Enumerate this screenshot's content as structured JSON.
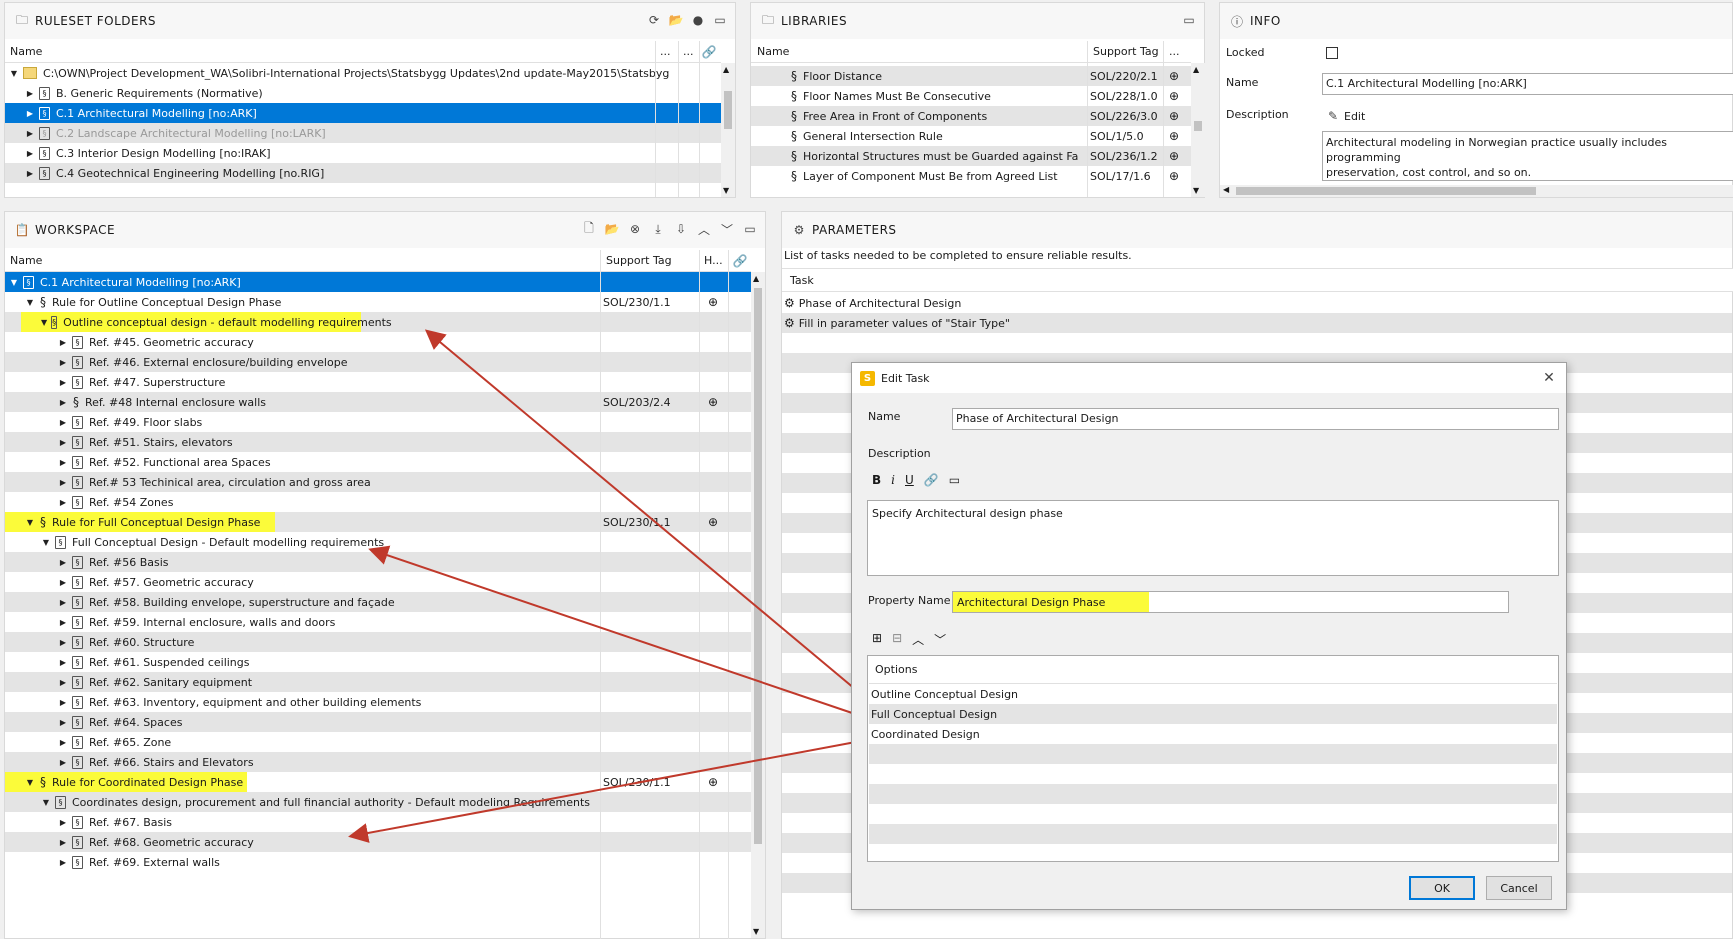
{
  "ruleset": {
    "title": "RULESET FOLDERS",
    "col_name": "Name",
    "col_dots1": "...",
    "col_dots2": "...",
    "rows": [
      {
        "label": "C:\\OWN\\Project Development_WA\\Solibri-International Projects\\Statsbygg Updates\\2nd update-May2015\\Statsbyg"
      },
      {
        "label": "B. Generic Requirements (Normative)"
      },
      {
        "label": "C.1 Architectural Modelling [no:ARK]"
      },
      {
        "label": "C.2 Landscape Architectural Modelling [no:LARK]"
      },
      {
        "label": "C.3 Interior Design Modelling [no:IRAK]"
      },
      {
        "label": "C.4 Geotechnical Engineering Modelling [no.RIG]"
      }
    ]
  },
  "libraries": {
    "title": "LIBRARIES",
    "col_name": "Name",
    "col_tag": "Support Tag",
    "col_dots": "...",
    "rows": [
      {
        "name": "Floor Distance",
        "tag": "SOL/220/2.1"
      },
      {
        "name": "Floor Names Must Be Consecutive",
        "tag": "SOL/228/1.0"
      },
      {
        "name": "Free Area in Front of Components",
        "tag": "SOL/226/3.0"
      },
      {
        "name": "General Intersection Rule",
        "tag": "SOL/1/5.0"
      },
      {
        "name": "Horizontal Structures must be Guarded against Fallin",
        "tag": "SOL/236/1.2"
      },
      {
        "name": "Layer of Component Must Be from Agreed List",
        "tag": "SOL/17/1.6"
      }
    ]
  },
  "info": {
    "title": "INFO",
    "locked_label": "Locked",
    "name_label": "Name",
    "name_value": "C.1 Architectural Modelling [no:ARK]",
    "desc_label": "Description",
    "edit_label": "Edit",
    "desc_line1": "Architectural modeling in Norwegian practice usually includes programming",
    "desc_line2": "preservation, cost control, and so on."
  },
  "workspace": {
    "title": "WORKSPACE",
    "col_name": "Name",
    "col_tag": "Support Tag",
    "col_h": "H...",
    "rows": [
      {
        "label": "C.1 Architectural Modelling [no:ARK]",
        "tag": ""
      },
      {
        "label": "Rule for Outline Conceptual Design Phase",
        "tag": "SOL/230/1.1"
      },
      {
        "label": "Outline conceptual design - default modelling requirements",
        "tag": ""
      },
      {
        "label": "Ref. #45. Geometric accuracy",
        "tag": ""
      },
      {
        "label": "Ref. #46. External enclosure/building envelope",
        "tag": ""
      },
      {
        "label": "Ref. #47. Superstructure",
        "tag": ""
      },
      {
        "label": "Ref. #48 Internal enclosure walls",
        "tag": "SOL/203/2.4"
      },
      {
        "label": "Ref. #49. Floor slabs",
        "tag": ""
      },
      {
        "label": "Ref. #51. Stairs, elevators",
        "tag": ""
      },
      {
        "label": "Ref. #52. Functional area Spaces",
        "tag": ""
      },
      {
        "label": "Ref.# 53 Techinical area, circulation and gross area",
        "tag": ""
      },
      {
        "label": "Ref. #54 Zones",
        "tag": ""
      },
      {
        "label": "Rule for Full Conceptual Design Phase",
        "tag": "SOL/230/1.1"
      },
      {
        "label": "Full Conceptual Design - Default modelling requirements",
        "tag": ""
      },
      {
        "label": "Ref. #56 Basis",
        "tag": ""
      },
      {
        "label": "Ref. #57. Geometric accuracy",
        "tag": ""
      },
      {
        "label": "Ref. #58. Building envelope, superstructure and façade",
        "tag": ""
      },
      {
        "label": "Ref. #59. Internal enclosure, walls and doors",
        "tag": ""
      },
      {
        "label": "Ref. #60. Structure",
        "tag": ""
      },
      {
        "label": "Ref. #61. Suspended ceilings",
        "tag": ""
      },
      {
        "label": "Ref. #62. Sanitary equipment",
        "tag": ""
      },
      {
        "label": "Ref. #63. Inventory, equipment and other building elements",
        "tag": ""
      },
      {
        "label": "Ref. #64. Spaces",
        "tag": ""
      },
      {
        "label": "Ref. #65. Zone",
        "tag": ""
      },
      {
        "label": "Ref. #66. Stairs and Elevators",
        "tag": ""
      },
      {
        "label": "Rule for Coordinated Design Phase",
        "tag": "SOL/230/1.1"
      },
      {
        "label": "Coordinates design, procurement and full financial authority - Default modeling Requirements",
        "tag": ""
      },
      {
        "label": "Ref. #67. Basis",
        "tag": ""
      },
      {
        "label": "Ref. #68. Geometric accuracy",
        "tag": ""
      },
      {
        "label": "Ref. #69. External walls",
        "tag": ""
      }
    ]
  },
  "parameters": {
    "title": "PARAMETERS",
    "subtitle": "List of tasks needed to be completed to ensure reliable results.",
    "col_task": "Task",
    "tasks": [
      {
        "label": "Phase of Architectural Design"
      },
      {
        "label": "Fill in parameter values of \"Stair Type\""
      }
    ]
  },
  "dialog": {
    "title": "Edit Task",
    "name_label": "Name",
    "name_value": "Phase of Architectural Design",
    "desc_label": "Description",
    "desc_text": "Specify Architectural design phase",
    "prop_label": "Property Name",
    "prop_value": "Architectural Design Phase",
    "options_header": "Options",
    "options": [
      "Outline Conceptual Design",
      "Full Conceptual Design",
      "Coordinated Design"
    ],
    "ok_label": "OK",
    "cancel_label": "Cancel"
  },
  "colors": {
    "selection": "#0078d7",
    "highlight": "#fbfb3a",
    "arrow": "#c0392b"
  }
}
